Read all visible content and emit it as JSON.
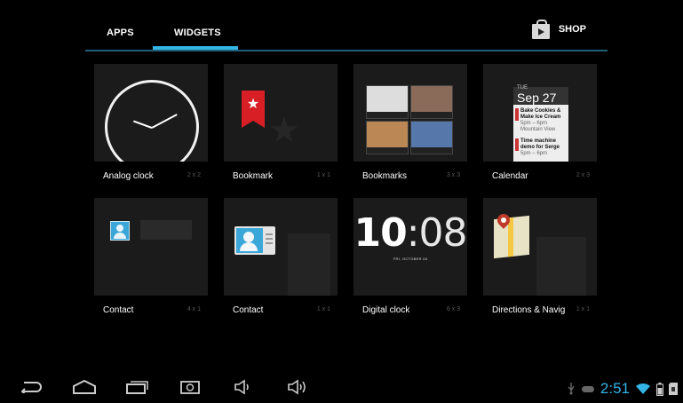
{
  "tabs": {
    "apps": "APPS",
    "widgets": "WIDGETS",
    "selected": "widgets",
    "shop": "SHOP",
    "shop_icon": "shop-bag-icon"
  },
  "widgets": [
    {
      "name": "Analog clock",
      "size": "2 x 2"
    },
    {
      "name": "Bookmark",
      "size": "1 x 1"
    },
    {
      "name": "Bookmarks",
      "size": "3 x 3"
    },
    {
      "name": "Calendar",
      "size": "2 x 3"
    },
    {
      "name": "Contact",
      "size": "4 x 1"
    },
    {
      "name": "Contact",
      "size": "1 x 1"
    },
    {
      "name": "Digital clock",
      "size": "6 x 3"
    },
    {
      "name": "Directions & Navig",
      "size": "1 x 1"
    }
  ],
  "previews": {
    "calendar": {
      "dow": "TUE",
      "date": "Sep 27",
      "events": [
        {
          "title": "Bake Cookies &",
          "title2": "Make Ice Cream",
          "time": "5pm – 6pm",
          "place": "Mountain View"
        },
        {
          "title": "Time machine",
          "title2": "demo for Serge",
          "time": "5pm – 6pm"
        }
      ]
    },
    "digital_clock": {
      "hours": "10",
      "minutes": ":08",
      "date": "FRI, OCTOBER 06"
    }
  },
  "navbar": {
    "buttons": [
      "back-icon",
      "home-icon",
      "recent-apps-icon",
      "screenshot-icon",
      "volume-down-icon",
      "volume-up-icon"
    ]
  },
  "status": {
    "time": "2:51",
    "icons": [
      "usb-icon",
      "game-controller-icon",
      "wifi-icon",
      "battery-icon",
      "sd-card-icon"
    ]
  },
  "colors": {
    "accent": "#33b5e5",
    "background": "#000000",
    "tile": "#1b1b1b"
  }
}
